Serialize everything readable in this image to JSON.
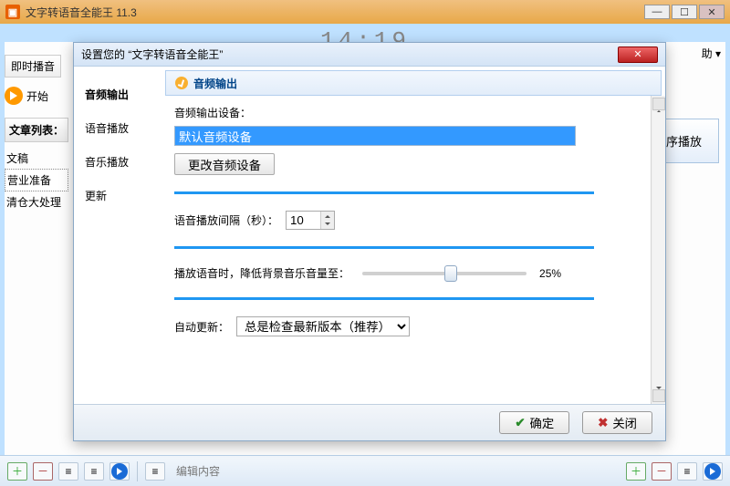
{
  "app": {
    "title": "文字转语音全能王 11.3"
  },
  "clock": "14:19",
  "help_label": "助 ▾",
  "left": {
    "tab_instant": "即时播音",
    "tab_more": "ㅣ",
    "start": "开始",
    "list_header": "文章列表：",
    "items": [
      "文稿",
      "营业准备",
      "清仓大处理"
    ]
  },
  "right": {
    "seq_play": "顺序播放"
  },
  "bottom": {
    "edit_hint": "编辑内容"
  },
  "dialog": {
    "title": "设置您的 “文字转语音全能王”",
    "side": {
      "items": [
        "音频输出",
        "语音播放",
        "音乐播放",
        "更新"
      ],
      "selected": 0
    },
    "header": "音频输出",
    "device_label": "音频输出设备：",
    "device_value": "默认音频设备",
    "change_device": "更改音频设备",
    "interval_label": "语音播放间隔（秒）：",
    "interval_value": "10",
    "bgm_label": "播放语音时，降低背景音乐音量至：",
    "bgm_percent": "25%",
    "bgm_pos_pct": 50,
    "autoupdate_label": "自动更新：",
    "autoupdate_value": "总是检查最新版本（推荐）",
    "ok": "确定",
    "close": "关闭"
  }
}
